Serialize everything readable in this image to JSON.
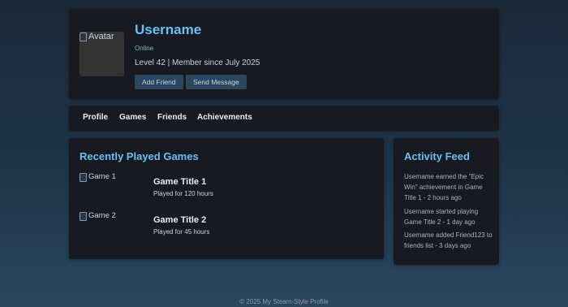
{
  "profile": {
    "avatar_alt": "Avatar",
    "username": "Username",
    "status": "Online",
    "level_line": "Level 42 | Member since July 2025",
    "add_friend_label": "Add Friend",
    "send_message_label": "Send Message"
  },
  "nav": {
    "items": [
      {
        "label": "Profile"
      },
      {
        "label": "Games"
      },
      {
        "label": "Friends"
      },
      {
        "label": "Achievements"
      }
    ]
  },
  "recent_games": {
    "title": "Recently Played Games",
    "games": [
      {
        "image_alt": "Game 1",
        "title": "Game Title 1",
        "played": "Played for 120 hours"
      },
      {
        "image_alt": "Game 2",
        "title": "Game Title 2",
        "played": "Played for 45 hours"
      }
    ]
  },
  "activity_feed": {
    "title": "Activity Feed",
    "items": [
      {
        "text": "Username earned the \"Epic Win\" achievement in Game Title 1 - 2 hours ago"
      },
      {
        "text": "Username started playing Game Title 2 - 1 day ago"
      },
      {
        "text": "Username added Friend123 to friends list - 3 days ago"
      }
    ]
  },
  "footer": {
    "text": "© 2025 My Steam-Style Profile"
  },
  "colors": {
    "accent": "#66c0f4",
    "card_bg": "#171a21",
    "button_bg": "#2a475e"
  }
}
